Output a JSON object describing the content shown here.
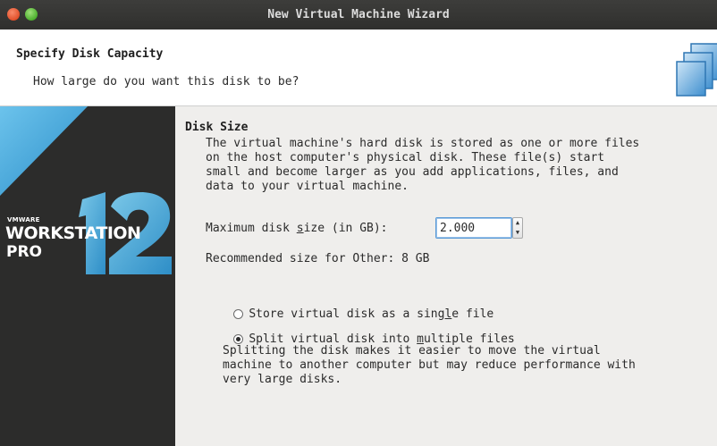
{
  "window": {
    "title": "New Virtual Machine Wizard"
  },
  "header": {
    "title": "Specify Disk Capacity",
    "subtitle": "How large do you want this disk to be?"
  },
  "sidebar": {
    "brand_vmware": "VMWARE",
    "brand_product": "WORKSTATION",
    "brand_edition": "PRO",
    "brand_version": "12"
  },
  "disk_size": {
    "section_title": "Disk Size",
    "description": "The virtual machine's hard disk is stored as one or more files\non the host computer's physical disk. These file(s) start\nsmall and become larger as you add applications, files, and\ndata to your virtual machine.",
    "max_size_label_pre": "Maximum disk ",
    "max_size_label_mnemonic": "s",
    "max_size_label_post": "ize (in GB):",
    "max_size_value": "2.000",
    "recommended": "Recommended size for Other: 8 GB"
  },
  "options": {
    "single_file": {
      "pre": "Store virtual disk as a sing",
      "mnemonic": "l",
      "post": "e file",
      "selected": false
    },
    "multiple_files": {
      "pre": "Split virtual disk into ",
      "mnemonic": "m",
      "post": "ultiple files",
      "selected": true
    },
    "split_description": "Splitting the disk makes it easier to move the virtual\nmachine to another computer but may reduce performance with\nvery large disks."
  },
  "colors": {
    "titlebar": "#333331",
    "sidebar": "#2c2c2b",
    "accent_blue": "#3b8fcf",
    "close": "#e2502a",
    "maximize": "#4caf2e"
  }
}
